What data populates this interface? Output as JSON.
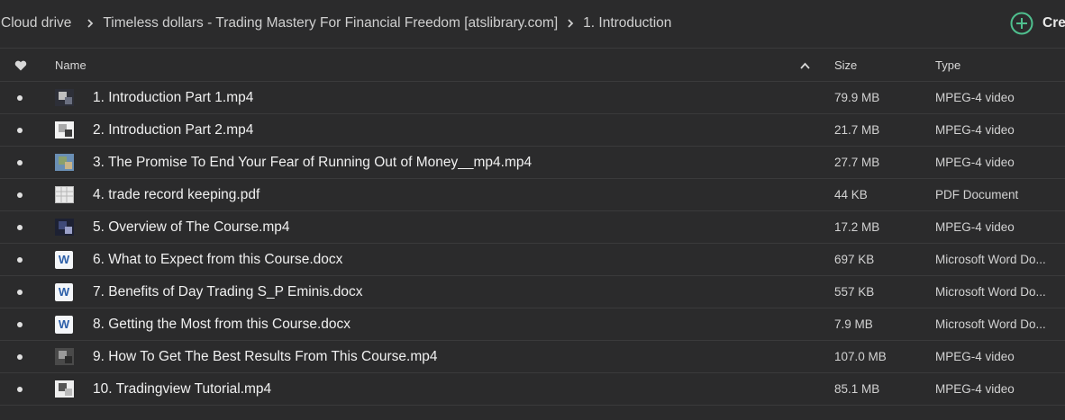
{
  "breadcrumb": {
    "items": [
      "Cloud drive",
      "Timeless dollars - Trading Mastery For Financial Freedom [atslibrary.com]",
      "1. Introduction"
    ]
  },
  "toolbar": {
    "create_label": "Create"
  },
  "colors": {
    "accent": "#4fbf8e",
    "background": "#2b2b2c",
    "divider": "#3a3a3b"
  },
  "table": {
    "headers": {
      "favorite_icon": "heart-icon",
      "name": "Name",
      "sort_icon": "chevron-up-icon",
      "size": "Size",
      "type": "Type"
    },
    "rows": [
      {
        "name": "1. Introduction Part 1.mp4",
        "size": "79.9 MB",
        "type": "MPEG-4 video",
        "icon": "video-thumbnail-icon"
      },
      {
        "name": "2. Introduction Part 2.mp4",
        "size": "21.7 MB",
        "type": "MPEG-4 video",
        "icon": "video-thumbnail-icon"
      },
      {
        "name": "3. The Promise To End Your Fear of Running Out of Money__mp4.mp4",
        "size": "27.7 MB",
        "type": "MPEG-4 video",
        "icon": "video-thumbnail-icon"
      },
      {
        "name": "4. trade record keeping.pdf",
        "size": "44 KB",
        "type": "PDF Document",
        "icon": "pdf-thumbnail-icon"
      },
      {
        "name": "5. Overview of The Course.mp4",
        "size": "17.2 MB",
        "type": "MPEG-4 video",
        "icon": "video-thumbnail-icon"
      },
      {
        "name": "6. What to Expect from this Course.docx",
        "size": "697 KB",
        "type": "Microsoft Word Do...",
        "icon": "word-doc-icon"
      },
      {
        "name": "7. Benefits of Day Trading S_P Eminis.docx",
        "size": "557 KB",
        "type": "Microsoft Word Do...",
        "icon": "word-doc-icon"
      },
      {
        "name": "8. Getting the Most from this Course.docx",
        "size": "7.9 MB",
        "type": "Microsoft Word Do...",
        "icon": "word-doc-icon"
      },
      {
        "name": "9. How To Get The Best Results From This Course.mp4",
        "size": "107.0 MB",
        "type": "MPEG-4 video",
        "icon": "video-thumbnail-icon"
      },
      {
        "name": "10. Tradingview Tutorial.mp4",
        "size": "85.1 MB",
        "type": "MPEG-4 video",
        "icon": "video-thumbnail-icon"
      }
    ]
  }
}
